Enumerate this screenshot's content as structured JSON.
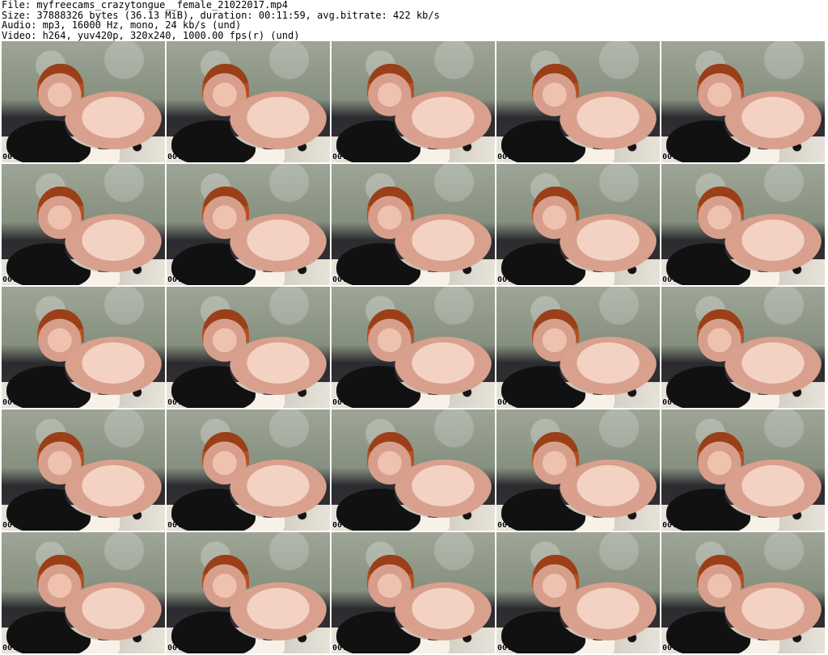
{
  "header": {
    "file": "File: myfreecams_crazytongue__female_21022017.mp4",
    "size": "Size: 37888326 bytes (36.13 MiB), duration: 00:11:59, avg.bitrate: 422 kb/s",
    "audio": "Audio: mp3, 16000 Hz, mono, 24 kb/s (und)",
    "video": "Video: h264, yuv420p, 320x240, 1000.00 fps(r) (und)"
  },
  "thumbnails": [
    {
      "timestamp": "00:00:27"
    },
    {
      "timestamp": "00:00:55"
    },
    {
      "timestamp": "00:01:22"
    },
    {
      "timestamp": "00:01:49"
    },
    {
      "timestamp": "00:02:15"
    },
    {
      "timestamp": "00:02:43"
    },
    {
      "timestamp": "00:03:09"
    },
    {
      "timestamp": "00:03:36"
    },
    {
      "timestamp": "00:04:03"
    },
    {
      "timestamp": "00:04:31"
    },
    {
      "timestamp": "00:04:57"
    },
    {
      "timestamp": "00:05:25"
    },
    {
      "timestamp": "00:05:52"
    },
    {
      "timestamp": "00:06:18"
    },
    {
      "timestamp": "00:06:45"
    },
    {
      "timestamp": "00:07:13"
    },
    {
      "timestamp": "00:07:39"
    },
    {
      "timestamp": "00:08:06"
    },
    {
      "timestamp": "00:08:34"
    },
    {
      "timestamp": "00:09:01"
    },
    {
      "timestamp": "00:09:27"
    },
    {
      "timestamp": "00:09:55"
    },
    {
      "timestamp": "00:10:22"
    },
    {
      "timestamp": "00:10:48"
    },
    {
      "timestamp": "00:11:16"
    }
  ]
}
